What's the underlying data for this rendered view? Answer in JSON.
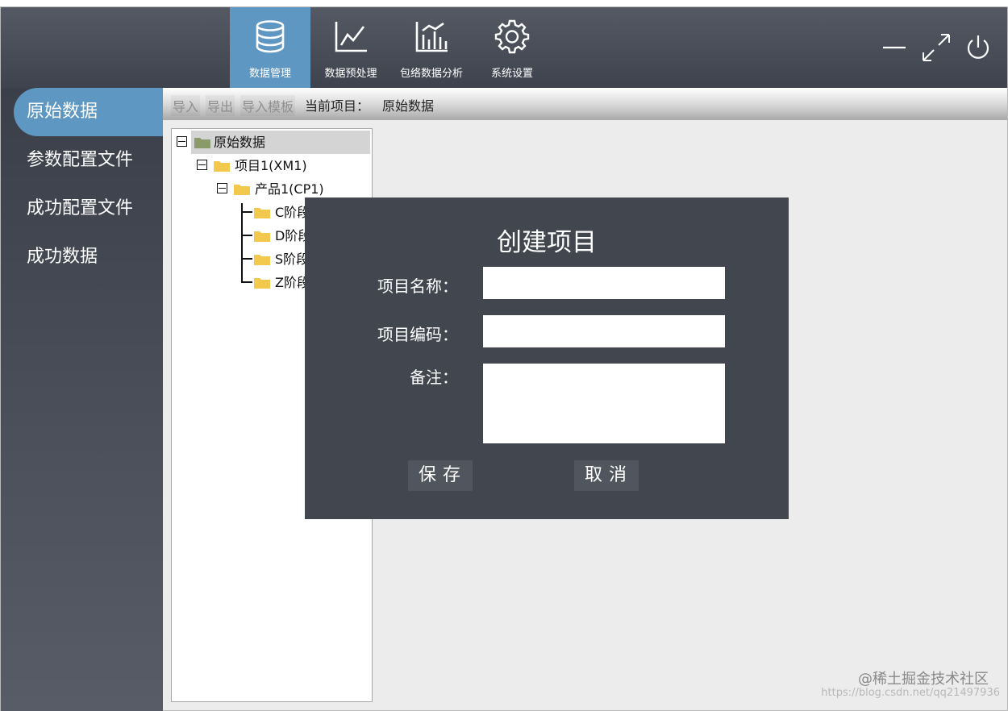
{
  "nav": {
    "items": [
      {
        "label": "数据管理",
        "icon": "database-icon",
        "active": true
      },
      {
        "label": "数据预处理",
        "icon": "line-chart-icon",
        "active": false
      },
      {
        "label": "包络数据分析",
        "icon": "bar-chart-icon",
        "active": false
      },
      {
        "label": "系统设置",
        "icon": "gear-icon",
        "active": false
      }
    ]
  },
  "window_controls": [
    "minimize-icon",
    "maximize-icon",
    "power-icon"
  ],
  "sidebar": {
    "items": [
      {
        "label": "原始数据",
        "active": true
      },
      {
        "label": "参数配置文件",
        "active": false
      },
      {
        "label": "成功配置文件",
        "active": false
      },
      {
        "label": "成功数据",
        "active": false
      }
    ]
  },
  "toolbar": {
    "import_label": "导入",
    "export_label": "导出",
    "import_template_label": "导入模板",
    "current_project_label": "当前项目：",
    "current_project_value": "原始数据"
  },
  "tree": {
    "root": "原始数据",
    "project": "项目1(XM1)",
    "product": "产品1(CP1)",
    "stages": [
      "C阶段",
      "D阶段",
      "S阶段",
      "Z阶段"
    ]
  },
  "dialog": {
    "title": "创建项目",
    "name_label": "项目名称：",
    "code_label": "项目编码：",
    "note_label": "备注：",
    "name_value": "",
    "code_value": "",
    "note_value": "",
    "save_label": "保存",
    "cancel_label": "取消"
  },
  "watermark": {
    "text": "@稀土掘金技术社区",
    "sub": "https://blog.csdn.net/qq21497936"
  },
  "colors": {
    "accent": "#5d97c2",
    "topbar": "#484c56",
    "dialog": "#42464f"
  }
}
